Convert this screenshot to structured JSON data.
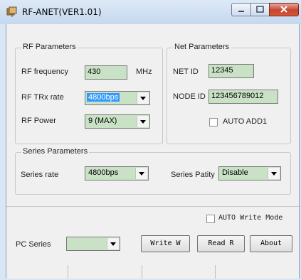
{
  "window": {
    "title": "RF-ANET(VER1.01)",
    "icon": "app-icon",
    "controls": [
      "minimize-icon",
      "maximize-icon",
      "close-icon"
    ],
    "close_color": "#c6452f"
  },
  "rf_parameters": {
    "title": "RF Parameters",
    "frequency_label": "RF frequency",
    "frequency_value": "430",
    "frequency_unit": "MHz",
    "trx_rate_label": "RF TRx rate",
    "trx_rate_value": "4800bps",
    "power_label": "RF Power",
    "power_value": "9 (MAX)"
  },
  "net_parameters": {
    "title": "Net Parameters",
    "net_id_label": "NET ID",
    "net_id_value": "12345",
    "node_id_label": "NODE ID",
    "node_id_value": "123456789012",
    "auto_add_label": "AUTO ADD1",
    "auto_add_checked": false
  },
  "series_parameters": {
    "title": "Series Parameters",
    "rate_label": "Series rate",
    "rate_value": "4800bps",
    "parity_label": "Series Patity",
    "parity_value": "Disable"
  },
  "bottom": {
    "auto_write_label": "AUTO Write Mode",
    "auto_write_checked": false,
    "pc_series_label": "PC Series",
    "pc_series_value": "",
    "write_button": "Write W",
    "read_button": "Read R",
    "about_button": "About"
  },
  "colors": {
    "field_bg": "#c9e2c6",
    "selection": "#3399ff"
  }
}
